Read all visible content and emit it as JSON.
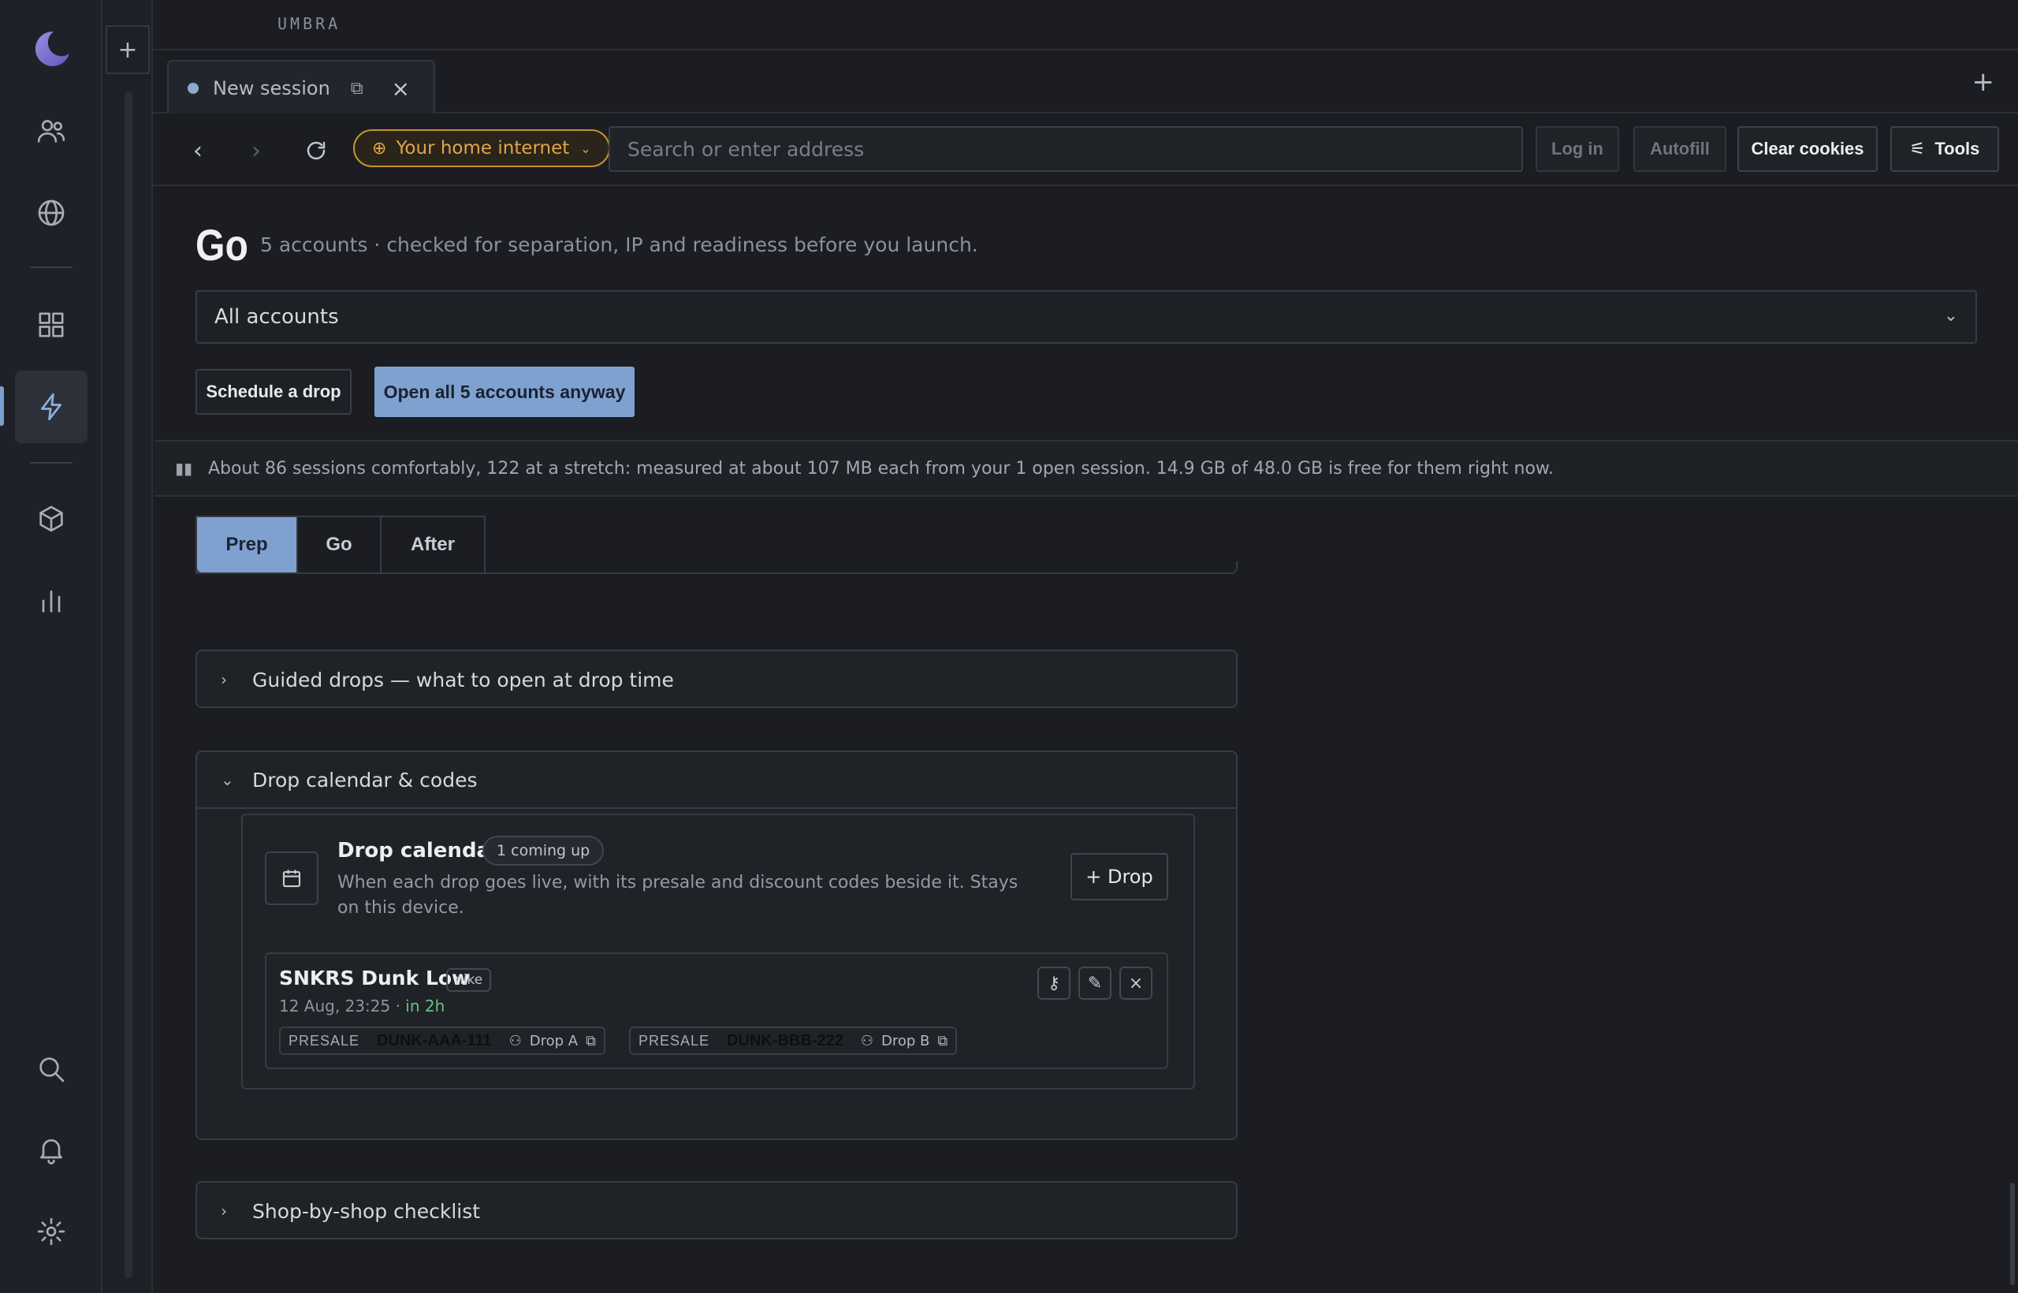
{
  "app": {
    "brand": "UMBRA"
  },
  "rail": {
    "items": [
      "logo-icon",
      "people-icon",
      "globe-icon",
      "grid-icon",
      "bolt-icon",
      "cube-icon",
      "chart-icon",
      "search-icon",
      "bell-icon",
      "gear-icon"
    ],
    "active": "bolt-icon",
    "accent": "#7c9fd1"
  },
  "strip": {
    "add_label": "+"
  },
  "tabs": [
    {
      "title": "New session",
      "active": true
    }
  ],
  "tabbar": {
    "new_tab_label": "+"
  },
  "nav": {
    "proxy_label": "Your home internet",
    "address_placeholder": "Search or enter address",
    "login_label": "Log in",
    "autofill_label": "Autofill",
    "clear_cookies_label": "Clear cookies",
    "tools_label": "Tools"
  },
  "page": {
    "title": "Go",
    "subtitle": "5 accounts · checked for separation, IP and readiness before you launch.",
    "account_select": "All accounts",
    "schedule_label": "Schedule a drop",
    "open_all_label": "Open all 5 accounts anyway",
    "capacity_text": "About 86 sessions comfortably, 122 at a stretch: measured at about 107 MB each from your 1 open session. 14.9 GB of 48.0 GB is free for them right now.",
    "segments": [
      "Prep",
      "Go",
      "After"
    ],
    "active_segment": "Prep"
  },
  "sections": {
    "guided": "Guided drops — what to open at drop time",
    "calendar_section": "Drop calendar & codes",
    "checklist": "Shop-by-shop checklist"
  },
  "calendar": {
    "title": "Drop calendar",
    "badge": "1 coming up",
    "description": "When each drop goes live, with its presale and discount codes beside it. Stays on this device.",
    "add_label": "+ Drop",
    "drops": [
      {
        "name": "SNKRS Dunk Low",
        "tag": "nike",
        "time": "12 Aug, 23:25 ·",
        "countdown": "in 2h",
        "codes": [
          {
            "kind": "PRESALE",
            "code": "DUNK-AAA-111",
            "assignee": "Drop A"
          },
          {
            "kind": "PRESALE",
            "code": "DUNK-BBB-222",
            "assignee": "Drop B"
          }
        ]
      }
    ]
  },
  "colors": {
    "primary": "#7fa1d0",
    "proxy": "#e1a647",
    "live": "#66c47f",
    "background": "#1b1d22"
  }
}
